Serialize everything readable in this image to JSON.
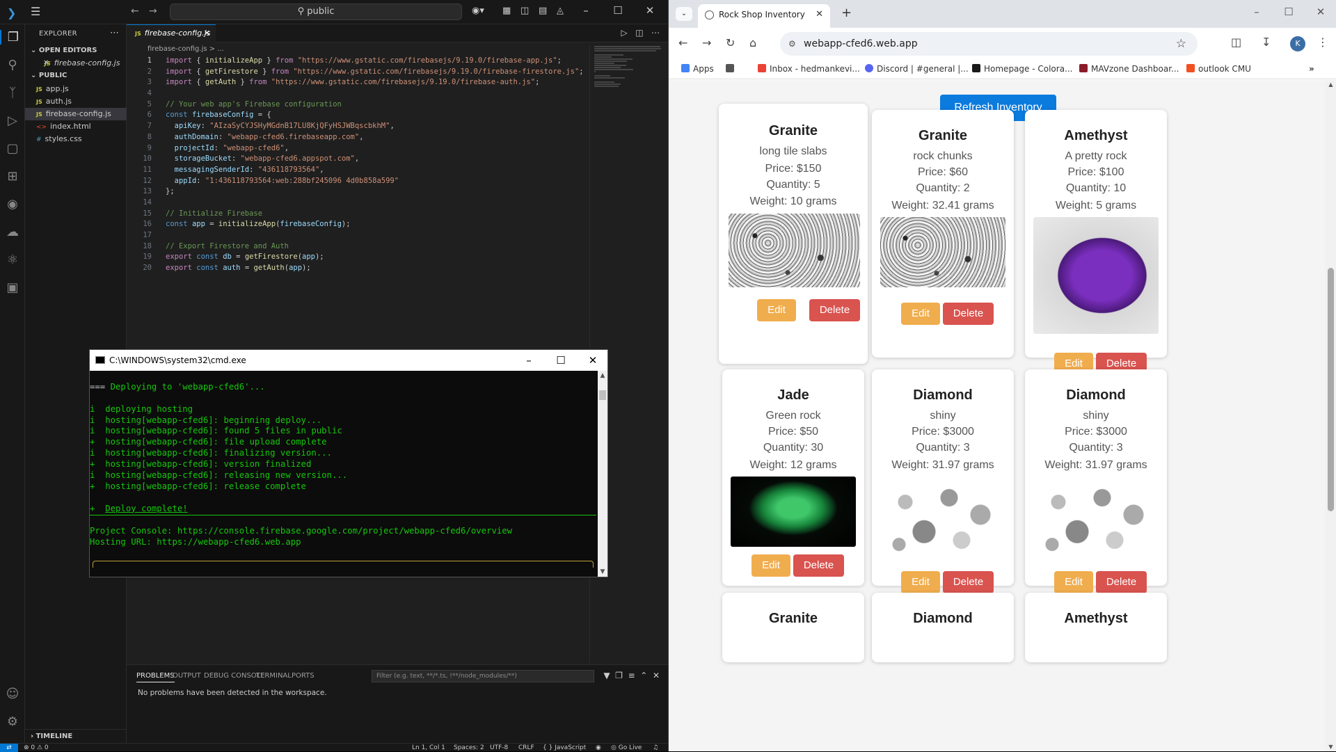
{
  "vscode": {
    "search_text": "public",
    "explorer_title": "EXPLORER",
    "open_editors_label": "OPEN EDITORS",
    "open_editor_file": "firebase-config.js",
    "folder_label": "PUBLIC",
    "files": [
      {
        "name": "app.js",
        "type": "js"
      },
      {
        "name": "auth.js",
        "type": "js"
      },
      {
        "name": "firebase-config.js",
        "type": "js",
        "selected": true
      },
      {
        "name": "index.html",
        "type": "html"
      },
      {
        "name": "styles.css",
        "type": "css"
      }
    ],
    "timeline_label": "TIMELINE",
    "active_tab": "firebase-config.js",
    "breadcrumb": "firebase-config.js > ...",
    "code_lines": [
      "import { initializeApp } from \"https://www.gstatic.com/firebasejs/9.19.0/firebase-app.js\";",
      "import { getFirestore } from \"https://www.gstatic.com/firebasejs/9.19.0/firebase-firestore.js\";",
      "import { getAuth } from \"https://www.gstatic.com/firebasejs/9.19.0/firebase-auth.js\";",
      "",
      "// Your web app's Firebase configuration",
      "const firebaseConfig = {",
      "  apiKey: \"AIzaSyCYJSHyMGdnB17LU8KjQFyHSJWBqscbkhM\",",
      "  authDomain: \"webapp-cfed6.firebaseapp.com\",",
      "  projectId: \"webapp-cfed6\",",
      "  storageBucket: \"webapp-cfed6.appspot.com\",",
      "  messagingSenderId: \"436118793564\",",
      "  appId: \"1:436118793564:web:288bf245096 4d0b858a599\"",
      "};",
      "",
      "// Initialize Firebase",
      "const app = initializeApp(firebaseConfig);",
      "",
      "// Export Firestore and Auth",
      "export const db = getFirestore(app);",
      "export const auth = getAuth(app);"
    ],
    "panel_tabs": [
      "PROBLEMS",
      "OUTPUT",
      "DEBUG CONSOLE",
      "TERMINAL",
      "PORTS"
    ],
    "panel_filter_placeholder": "Filter (e.g. text, **/*.ts, !**/node_modules/**)",
    "panel_message": "No problems have been detected in the workspace.",
    "status": {
      "problems": "⊗ 0 ⚠ 0",
      "position": "Ln 1, Col 1",
      "spaces": "Spaces: 2",
      "encoding": "UTF-8",
      "eol": "CRLF",
      "language": "JavaScript",
      "golive": "Go Live"
    }
  },
  "cmd": {
    "title": "C:\\WINDOWS\\system32\\cmd.exe",
    "lines": [
      {
        "text": "",
        "color": "green"
      },
      {
        "text": "=== Deploying to 'webapp-cfed6'...",
        "color": "mixed"
      },
      {
        "text": "",
        "color": "green"
      },
      {
        "text": "i  deploying hosting",
        "color": "green"
      },
      {
        "text": "i  hosting[webapp-cfed6]: beginning deploy...",
        "color": "green"
      },
      {
        "text": "i  hosting[webapp-cfed6]: found 5 files in public",
        "color": "green"
      },
      {
        "text": "+  hosting[webapp-cfed6]: file upload complete",
        "color": "green"
      },
      {
        "text": "i  hosting[webapp-cfed6]: finalizing version...",
        "color": "green"
      },
      {
        "text": "+  hosting[webapp-cfed6]: version finalized",
        "color": "green"
      },
      {
        "text": "i  hosting[webapp-cfed6]: releasing new version...",
        "color": "green"
      },
      {
        "text": "+  hosting[webapp-cfed6]: release complete",
        "color": "green"
      },
      {
        "text": "",
        "color": "green"
      },
      {
        "text": "+  Deploy complete!",
        "color": "green"
      }
    ],
    "console_line": "Project Console: https://console.firebase.google.com/project/webapp-cfed6/overview",
    "hosting_line": "Hosting URL: https://webapp-cfed6.web.app"
  },
  "chrome": {
    "tab_title": "Rock Shop Inventory",
    "url": "webapp-cfed6.web.app",
    "bookmarks": [
      {
        "label": "Apps",
        "color": "#4285f4"
      },
      {
        "label": "",
        "color": "#555555"
      },
      {
        "label": "Inbox - hedmankevi...",
        "color": "#ea4335"
      },
      {
        "label": "Discord | #general |...",
        "color": "#5865f2"
      },
      {
        "label": "Homepage - Colora...",
        "color": "#1a1a1a"
      },
      {
        "label": "MAVzone Dashboar...",
        "color": "#8b1c2b"
      },
      {
        "label": "outlook CMU",
        "color": "#f25022"
      }
    ],
    "avatar_initial": "K"
  },
  "page": {
    "refresh_label": "Refresh Inventory",
    "edit_label": "Edit",
    "delete_label": "Delete",
    "cards": [
      {
        "name": "Granite",
        "desc": "long tile slabs",
        "price": "Price: $150",
        "qty": "Quantity: 5",
        "weight": "Weight: 10 grams",
        "image": "granite"
      },
      {
        "name": "Granite",
        "desc": "rock chunks",
        "price": "Price: $60",
        "qty": "Quantity: 2",
        "weight": "Weight: 32.41 grams",
        "image": "granite"
      },
      {
        "name": "Amethyst",
        "desc": "A pretty rock",
        "price": "Price: $100",
        "qty": "Quantity: 10",
        "weight": "Weight: 5 grams",
        "image": "amethyst"
      },
      {
        "name": "Jade",
        "desc": "Green rock",
        "price": "Price: $50",
        "qty": "Quantity: 30",
        "weight": "Weight: 12 grams",
        "image": "jade"
      },
      {
        "name": "Diamond",
        "desc": "shiny",
        "price": "Price: $3000",
        "qty": "Quantity: 3",
        "weight": "Weight: 31.97 grams",
        "image": "diamond"
      },
      {
        "name": "Diamond",
        "desc": "shiny",
        "price": "Price: $3000",
        "qty": "Quantity: 3",
        "weight": "Weight: 31.97 grams",
        "image": "diamond"
      },
      {
        "name": "Granite"
      },
      {
        "name": "Diamond"
      },
      {
        "name": "Amethyst"
      }
    ]
  }
}
